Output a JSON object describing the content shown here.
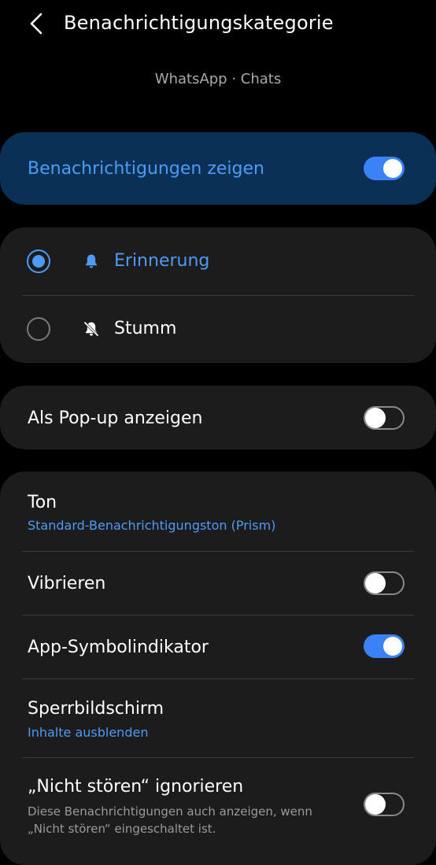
{
  "header": {
    "title": "Benachrichtigungskategorie",
    "back_icon": "chevron-left-icon"
  },
  "subtitle": "WhatsApp · Chats",
  "main_toggle": {
    "label": "Benachrichtigungen zeigen",
    "on": true
  },
  "alert_options": [
    {
      "label": "Erinnerung",
      "icon": "bell-icon",
      "selected": true
    },
    {
      "label": "Stumm",
      "icon": "bell-off-icon",
      "selected": false
    }
  ],
  "popup": {
    "label": "Als Pop-up anzeigen",
    "on": false
  },
  "settings": {
    "sound": {
      "label": "Ton",
      "value": "Standard-Benachrichtigungston (Prism)"
    },
    "vibrate": {
      "label": "Vibrieren",
      "on": false
    },
    "badge": {
      "label": "App-Symbolindikator",
      "on": true
    },
    "lockscreen": {
      "label": "Sperrbildschirm",
      "value": "Inhalte ausblenden"
    },
    "dnd": {
      "label": "„Nicht stören“ ignorieren",
      "description": "Diese Benachrichtigungen auch anzeigen, wenn „Nicht stören“ eingeschaltet ist.",
      "on": false
    }
  },
  "colors": {
    "accent": "#4d9bf7",
    "toggle_on": "#3b82f6",
    "card": "#1c1c1c",
    "main_card": "#0b3056"
  }
}
